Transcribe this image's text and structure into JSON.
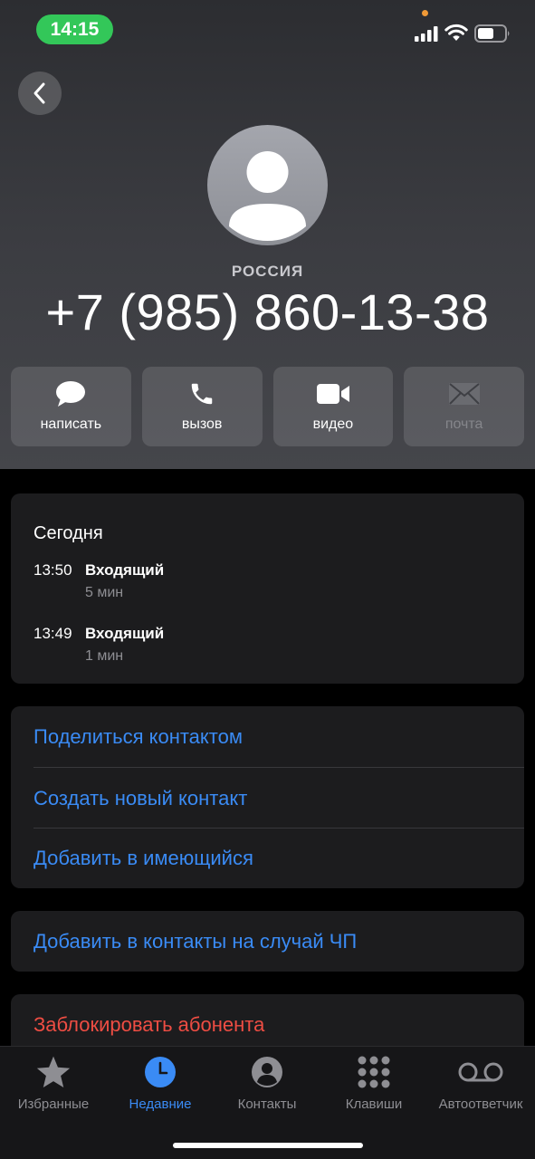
{
  "status": {
    "time": "14:15"
  },
  "contact": {
    "country": "РОССИЯ",
    "phone": "+7 (985) 860-13-38"
  },
  "actions": [
    {
      "label": "написать",
      "icon": "message-bubble-icon",
      "enabled": true
    },
    {
      "label": "вызов",
      "icon": "phone-icon",
      "enabled": true
    },
    {
      "label": "видео",
      "icon": "video-camera-icon",
      "enabled": true
    },
    {
      "label": "почта",
      "icon": "envelope-icon",
      "enabled": false
    }
  ],
  "history": {
    "title": "Сегодня",
    "calls": [
      {
        "time": "13:50",
        "type": "Входящий",
        "duration": "5 мин"
      },
      {
        "time": "13:49",
        "type": "Входящий",
        "duration": "1 мин"
      }
    ]
  },
  "options": [
    "Поделиться контактом",
    "Создать новый контакт",
    "Добавить в имеющийся"
  ],
  "emergency": "Добавить в контакты на случай ЧП",
  "block": "Заблокировать абонента",
  "tabs": [
    {
      "label": "Избранные",
      "icon": "star-icon",
      "active": false
    },
    {
      "label": "Недавние",
      "icon": "clock-icon",
      "active": true
    },
    {
      "label": "Контакты",
      "icon": "person-circle-icon",
      "active": false
    },
    {
      "label": "Клавиши",
      "icon": "keypad-icon",
      "active": false
    },
    {
      "label": "Автоответчик",
      "icon": "voicemail-icon",
      "active": false
    }
  ],
  "colors": {
    "accent": "#3a8bf5",
    "destructive": "#ee4d43",
    "status_green": "#33c759"
  }
}
